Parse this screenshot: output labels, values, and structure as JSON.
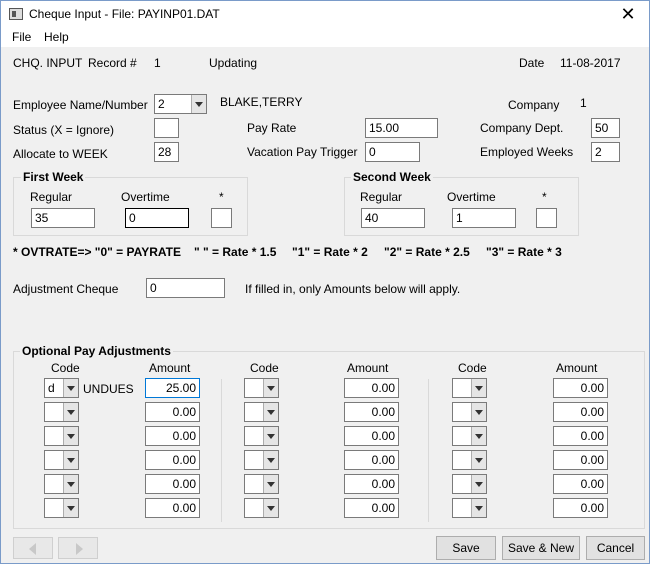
{
  "window": {
    "title": "Cheque Input - File: PAYINP01.DAT",
    "close": "✕"
  },
  "menu": {
    "file": "File",
    "help": "Help"
  },
  "header": {
    "form_name": "CHQ. INPUT",
    "record_label": "Record #",
    "record_value": "1",
    "mode": "Updating",
    "date_label": "Date",
    "date_value": "11-08-2017"
  },
  "employee": {
    "name_label": "Employee Name/Number",
    "number": "2",
    "name": "BLAKE,TERRY",
    "company_label": "Company",
    "company_value": "1",
    "status_label": "Status (X = Ignore)",
    "status_value": "",
    "allocate_label": "Allocate to WEEK",
    "allocate_value": "28",
    "pay_rate_label": "Pay Rate",
    "pay_rate_value": "15.00",
    "vacation_label": "Vacation Pay Trigger",
    "vacation_value": "0",
    "dept_label": "Company Dept.",
    "dept_value": "50",
    "weeks_label": "Employed Weeks",
    "weeks_value": "2"
  },
  "first_week": {
    "title": "First Week",
    "regular_label": "Regular",
    "overtime_label": "Overtime",
    "star_label": "*",
    "regular": "35",
    "overtime": "0",
    "star": ""
  },
  "second_week": {
    "title": "Second Week",
    "regular_label": "Regular",
    "overtime_label": "Overtime",
    "star_label": "*",
    "regular": "40",
    "overtime": "1",
    "star": ""
  },
  "ovtrate": {
    "prefix": "* OVTRATE=>  \"0\" = PAYRATE",
    "r1": "\" \" = Rate * 1.5",
    "r2": "\"1\" = Rate * 2",
    "r3": "\"2\" = Rate * 2.5",
    "r4": "\"3\" = Rate * 3"
  },
  "adjustment": {
    "label": "Adjustment Cheque",
    "value": "0",
    "note": "If filled in, only Amounts below will apply."
  },
  "optional": {
    "title": "Optional Pay Adjustments",
    "code_label": "Code",
    "amount_label": "Amount",
    "col1": [
      {
        "code": "d",
        "desc": "UNDUES",
        "amount": "25.00"
      },
      {
        "code": "",
        "desc": "",
        "amount": "0.00"
      },
      {
        "code": "",
        "desc": "",
        "amount": "0.00"
      },
      {
        "code": "",
        "desc": "",
        "amount": "0.00"
      },
      {
        "code": "",
        "desc": "",
        "amount": "0.00"
      },
      {
        "code": "",
        "desc": "",
        "amount": "0.00"
      }
    ],
    "col2": [
      "0.00",
      "0.00",
      "0.00",
      "0.00",
      "0.00",
      "0.00"
    ],
    "col3": [
      "0.00",
      "0.00",
      "0.00",
      "0.00",
      "0.00",
      "0.00"
    ]
  },
  "buttons": {
    "save": "Save",
    "save_new": "Save & New",
    "cancel": "Cancel"
  }
}
